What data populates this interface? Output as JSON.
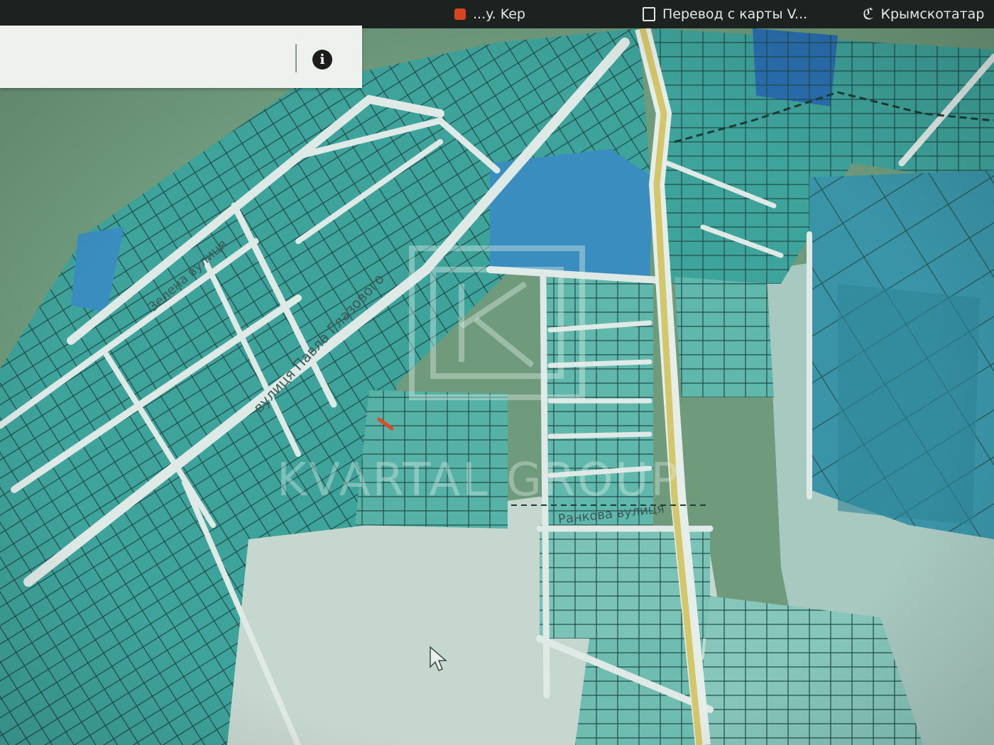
{
  "browser": {
    "tabs": [
      {
        "label": "...y. Kep",
        "icon": "app-red-icon"
      },
      {
        "label": "Перевод с карты V...",
        "icon": "bookmark-icon"
      },
      {
        "label": "Крымскотатар",
        "icon": "c-app-icon"
      }
    ]
  },
  "panel": {
    "search_value": "",
    "info_label": "i"
  },
  "streets": {
    "zelena": "Зелена вулиця",
    "glazovogo": "вулиця Павла Глазового",
    "rankova": "Ранкова вулиця"
  },
  "watermark": {
    "text": "KVARTAL GROUP",
    "logo": "kvartal-logo"
  },
  "colors": {
    "forest": "#6f9a7c",
    "parcel": "#3ea39b",
    "parcel_light": "#7bc3b6",
    "parcel_blue": "#3a8dbf",
    "parcel_deep_blue": "#2a6fb0",
    "road": "#dfe9e6",
    "main_road": "#d4c66a",
    "open_land": "#c6d7cf",
    "selected_parcel": "#e04a22"
  }
}
